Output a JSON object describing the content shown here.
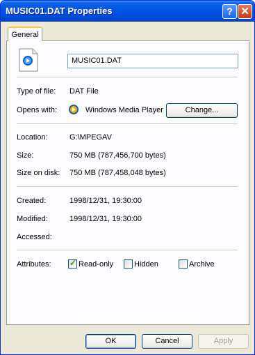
{
  "window": {
    "title": "MUSIC01.DAT Properties",
    "help_glyph": "?",
    "close_glyph": "✕"
  },
  "tabs": [
    {
      "label": "General"
    }
  ],
  "general": {
    "filename": "MUSIC01.DAT",
    "type_label": "Type of file:",
    "type_value": "DAT File",
    "opens_label": "Opens with:",
    "opens_value": "Windows Media Player",
    "change_button": "Change...",
    "location_label": "Location:",
    "location_value": "G:\\MPEGAV",
    "size_label": "Size:",
    "size_value": "750 MB (787,456,700 bytes)",
    "size_on_disk_label": "Size on disk:",
    "size_on_disk_value": "750 MB (787,458,048 bytes)",
    "created_label": "Created:",
    "created_value": "1998/12/31, 19:30:00",
    "modified_label": "Modified:",
    "modified_value": "1998/12/31, 19:30:00",
    "accessed_label": "Accessed:",
    "accessed_value": "",
    "attributes_label": "Attributes:",
    "attributes": [
      {
        "label": "Read-only",
        "checked": true
      },
      {
        "label": "Hidden",
        "checked": false
      },
      {
        "label": "Archive",
        "checked": false
      }
    ]
  },
  "buttons": {
    "ok": "OK",
    "cancel": "Cancel",
    "apply": "Apply"
  }
}
